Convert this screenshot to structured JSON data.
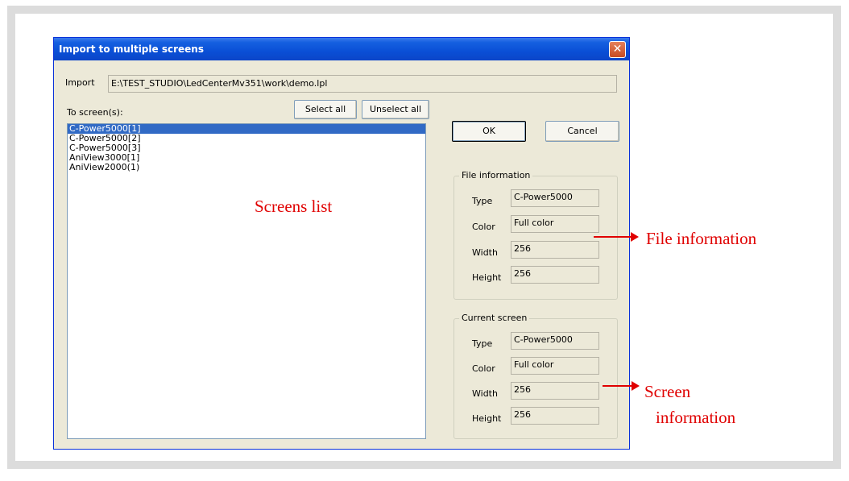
{
  "dialog": {
    "title": "Import to multiple screens",
    "close_glyph": "✕",
    "import_label": "Import",
    "import_path": "E:\\TEST_STUDIO\\LedCenterMv351\\work\\demo.lpl",
    "to_screens_label": "To screen(s):",
    "select_all_label": "Select all",
    "unselect_all_label": "Unselect all",
    "ok_label": "OK",
    "cancel_label": "Cancel",
    "screens": [
      "C-Power5000[1]",
      "C-Power5000[2]",
      "C-Power5000[3]",
      "AniView3000[1]",
      "AniView2000(1)"
    ],
    "file_information": {
      "title": "File information",
      "type_label": "Type",
      "type_value": "C-Power5000",
      "color_label": "Color",
      "color_value": "Full color",
      "width_label": "Width",
      "width_value": "256",
      "height_label": "Height",
      "height_value": "256"
    },
    "current_screen": {
      "title": "Current screen",
      "type_label": "Type",
      "type_value": "C-Power5000",
      "color_label": "Color",
      "color_value": "Full color",
      "width_label": "Width",
      "width_value": "256",
      "height_label": "Height",
      "height_value": "256"
    }
  },
  "annotations": {
    "screens_list": "Screens list",
    "file_information": "File information",
    "screen_information_line1": "Screen",
    "screen_information_line2": "information",
    "color": "#e00000"
  }
}
